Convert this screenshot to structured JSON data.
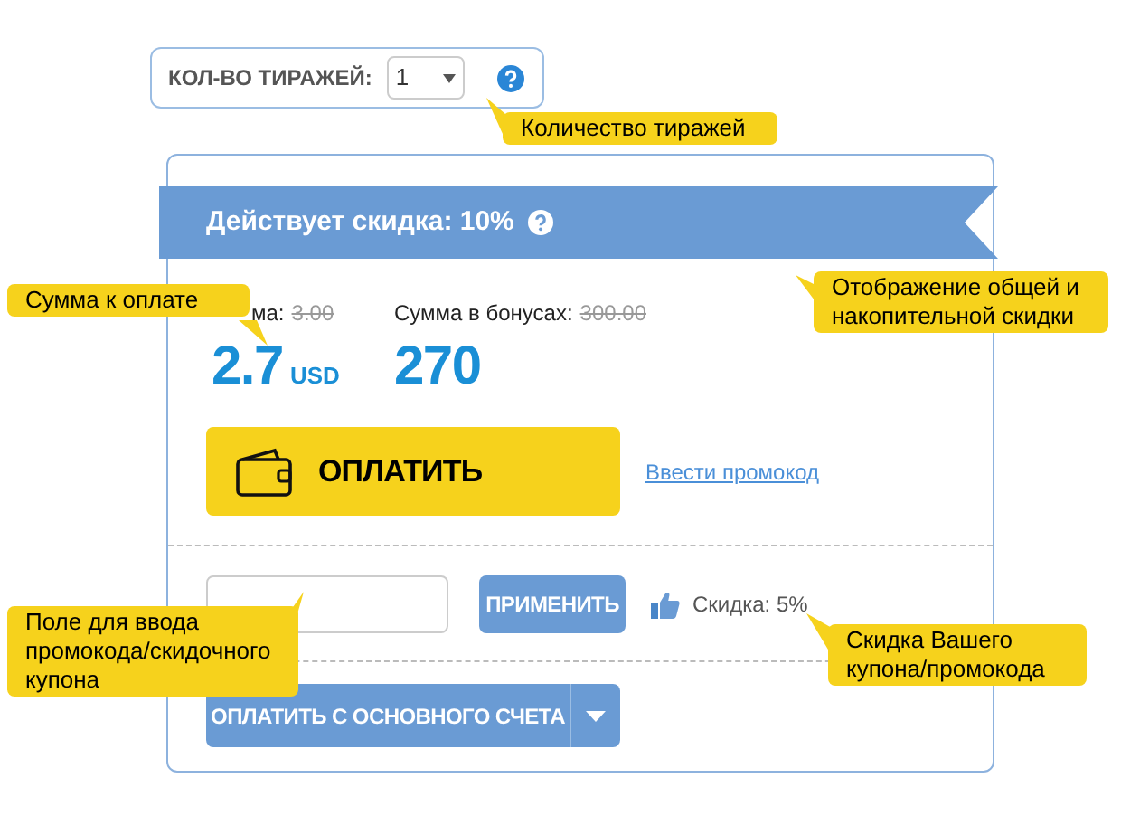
{
  "run_count": {
    "label": "КОЛ-ВО ТИРАЖЕЙ:",
    "value": "1"
  },
  "discount_banner": {
    "text": "Действует скидка: 10%"
  },
  "totals": [
    {
      "label": "ма:",
      "old": "3.00",
      "amount": "2.7",
      "currency": "USD"
    },
    {
      "label": "Сумма в бонусах:",
      "old": "300.00",
      "amount": "270"
    }
  ],
  "pay_button": "ОПЛАТИТЬ",
  "promo_link": "Ввести промокод",
  "promo": {
    "apply_button": "ПРИМЕНИТЬ",
    "discount": "Скидка: 5%"
  },
  "account_button": "ОПЛАТИТЬ С ОСНОВНОГО СЧЕТА",
  "callouts": [
    "Количество тиражей",
    "Сумма к оплате",
    "Отображение общей и накопительной скидки",
    "Поле для ввода промокода/скидочного купона",
    "Скидка Вашего купона/промокода"
  ]
}
